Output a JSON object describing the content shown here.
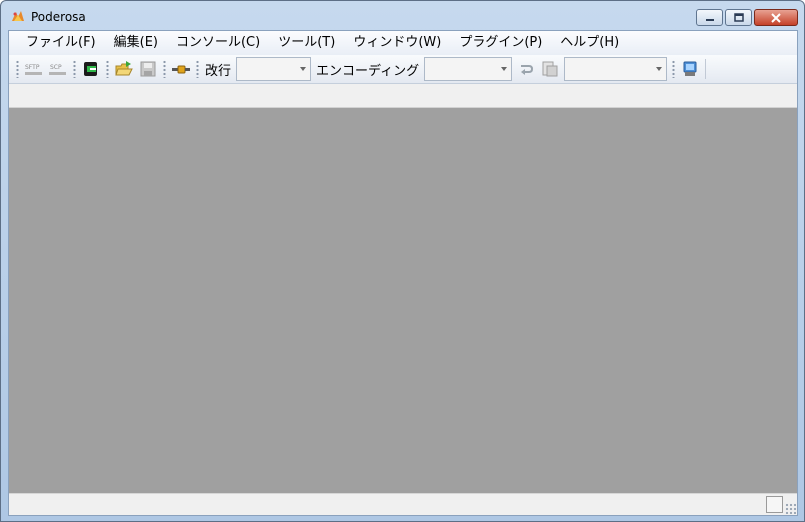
{
  "window": {
    "title": "Poderosa"
  },
  "menubar": {
    "items": [
      {
        "label": "ファイル(F)"
      },
      {
        "label": "編集(E)"
      },
      {
        "label": "コンソール(C)"
      },
      {
        "label": "ツール(T)"
      },
      {
        "label": "ウィンドウ(W)"
      },
      {
        "label": "プラグイン(P)"
      },
      {
        "label": "ヘルプ(H)"
      }
    ]
  },
  "toolbar": {
    "sftp_label": "SFTP",
    "scp_label": "SCP",
    "newline_label": "改行",
    "newline_value": "",
    "encoding_label": "エンコーディング",
    "encoding_value": "",
    "third_combo_value": "",
    "icons": [
      "sftp-icon",
      "scp-icon",
      "new-connection-icon",
      "open-folder-icon",
      "save-icon",
      "cable-icon",
      "line-wrap-icon",
      "page-icon",
      "shell-icon"
    ]
  },
  "statusbar": {
    "text": ""
  },
  "colors": {
    "workarea": "#a0a0a0",
    "titlebar": "#c6d9ee",
    "close_button": "#c54129"
  }
}
